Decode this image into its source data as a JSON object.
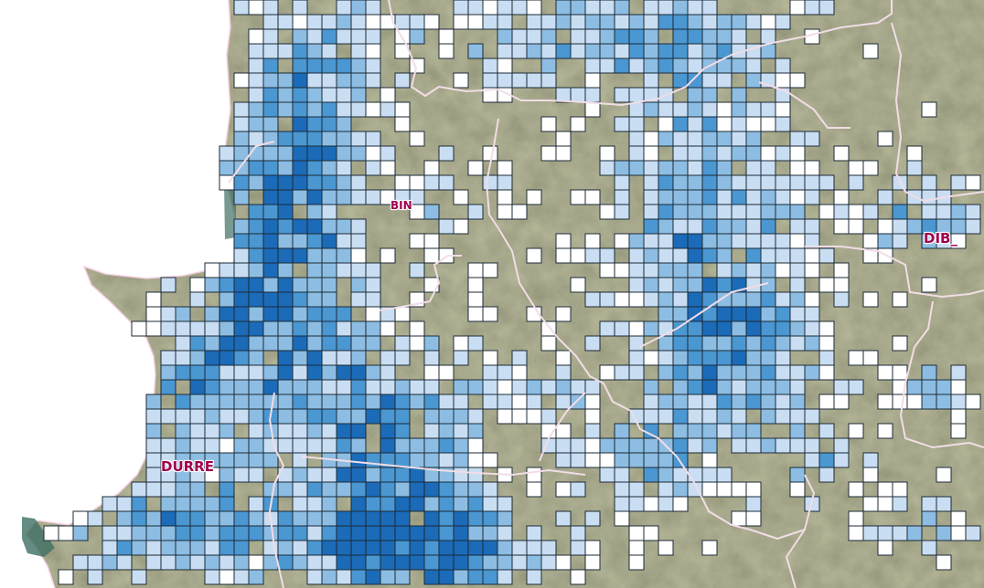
{
  "map": {
    "basemap": "satellite-imagery",
    "overlay": "choropleth-grid",
    "colors": {
      "sea": "#ffffff",
      "land": "#6b6a4e",
      "land_dark": "#4f5238",
      "land_light": "#8b8a66",
      "boundary": "#f1dde6",
      "coast_outline": "#f4cfe0",
      "grid_stroke": "#1c2a36",
      "grid_classes": [
        "#ffffff",
        "#c9def3",
        "#8dbde3",
        "#4a97d2",
        "#1b6bb8"
      ],
      "label": "#a0004e"
    }
  },
  "labels": {
    "durres": "DURRE",
    "dibe": "DIB_",
    "bin": "BIN"
  }
}
